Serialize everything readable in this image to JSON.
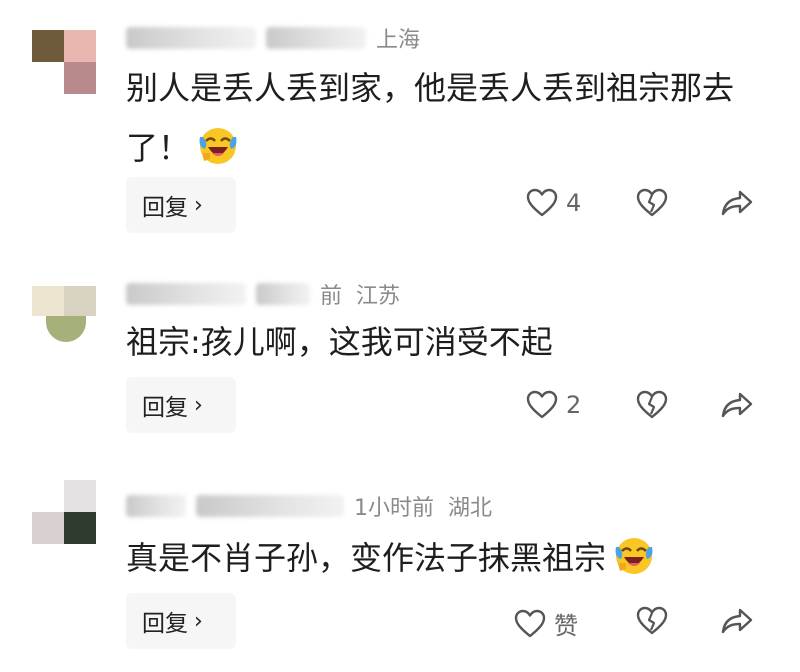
{
  "comments": [
    {
      "meta_location": "上海",
      "meta_time": "",
      "text": "别人是丢人丢到家，他是丢人丢到祖宗那去了！",
      "reply_label": "回复",
      "like_count": "4"
    },
    {
      "meta_time": "前",
      "meta_location": "江苏",
      "text": "祖宗:孩儿啊，这我可消受不起",
      "reply_label": "回复",
      "like_count": "2"
    },
    {
      "meta_time": "1小时前",
      "meta_location": "湖北",
      "text": "真是不肖子孙，变作法子抹黑祖宗",
      "reply_label": "回复",
      "like_count": "赞"
    }
  ],
  "icons": {
    "like": "heart-outline-icon",
    "dislike": "broken-heart-icon",
    "share": "share-arrow-icon",
    "emoji": "laughing-crying-emoji"
  },
  "colors": {
    "text": "#1e1e1e",
    "meta": "#8a8a8a",
    "reply_bg": "#f6f6f6",
    "icon": "#555555"
  }
}
